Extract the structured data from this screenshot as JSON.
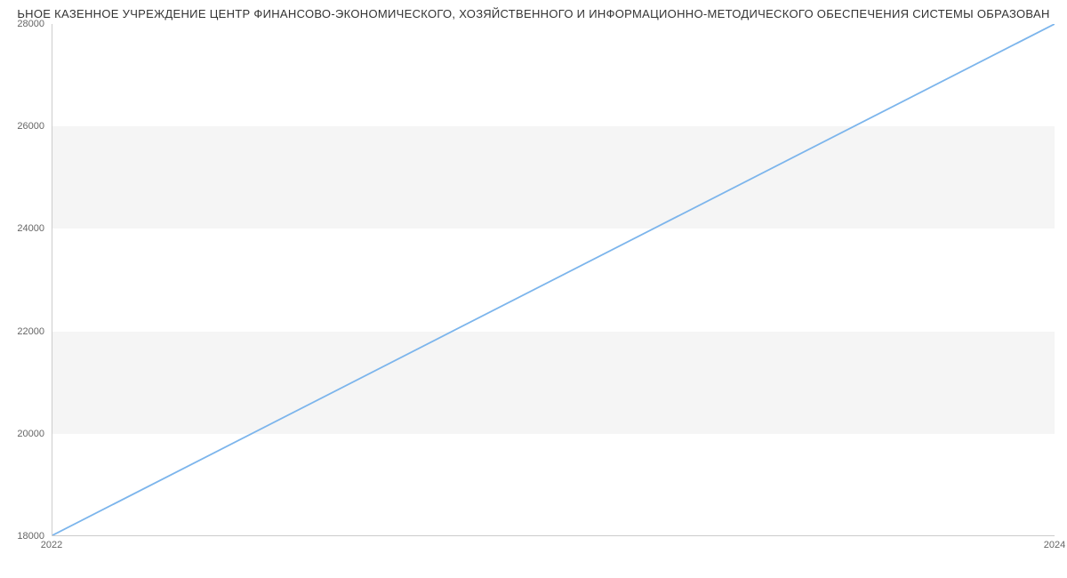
{
  "chart_data": {
    "type": "line",
    "title": "ЬНОЕ КАЗЕННОЕ УЧРЕЖДЕНИЕ ЦЕНТР ФИНАНСОВО-ЭКОНОМИЧЕСКОГО, ХОЗЯЙСТВЕННОГО И ИНФОРМАЦИОННО-МЕТОДИЧЕСКОГО ОБЕСПЕЧЕНИЯ СИСТЕМЫ ОБРАЗОВАН",
    "x": [
      2022,
      2024
    ],
    "values": [
      18000,
      28000
    ],
    "xlabel": "",
    "ylabel": "",
    "y_ticks": [
      18000,
      20000,
      22000,
      24000,
      26000,
      28000
    ],
    "x_ticks": [
      2022,
      2024
    ],
    "xlim": [
      2022,
      2024
    ],
    "ylim": [
      18000,
      28000
    ],
    "bands": [
      {
        "from": 20000,
        "to": 22000
      },
      {
        "from": 24000,
        "to": 26000
      }
    ],
    "series_color": "#7cb5ec"
  }
}
